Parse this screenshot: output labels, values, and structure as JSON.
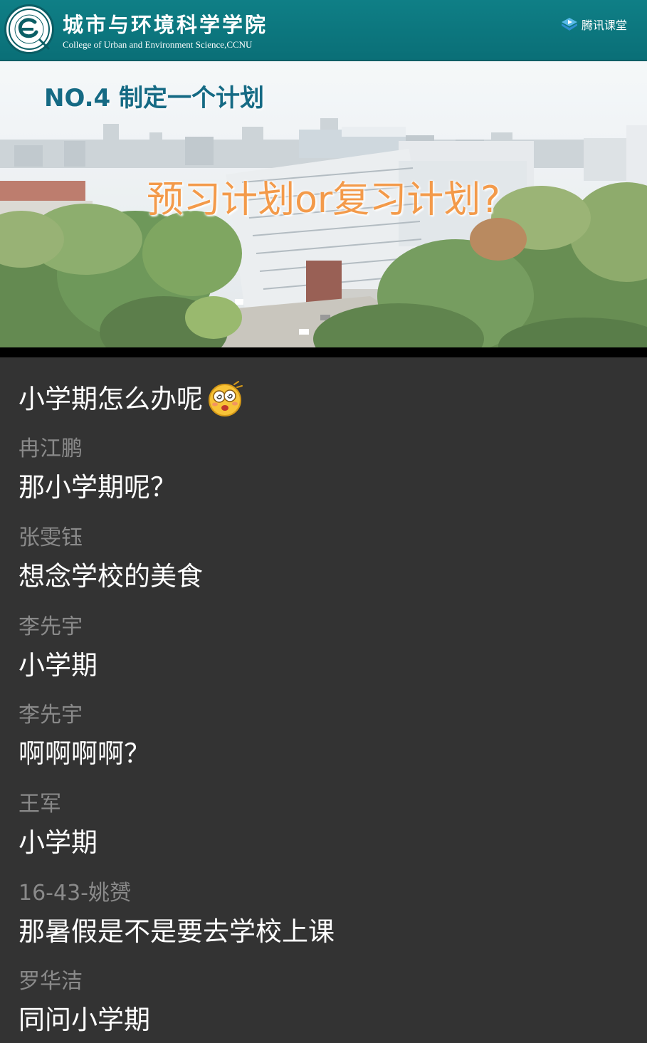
{
  "slide": {
    "college_name_cn": "城市与环境科学学院",
    "college_name_en": "College of Urban and Environment Science,CCNU",
    "platform_name": "腾讯课堂",
    "title": "NO.4  制定一个计划",
    "question": "预习计划or复习计划?"
  },
  "chat": {
    "first_message": {
      "text": "小学期怎么办呢",
      "emoji": "dizzy-face-emoji"
    },
    "messages": [
      {
        "sender": "冉江鹏",
        "text": "那小学期呢？"
      },
      {
        "sender": "张雯钰",
        "text": "想念学校的美食"
      },
      {
        "sender": "李先宇",
        "text": "小学期"
      },
      {
        "sender": "李先宇",
        "text": "啊啊啊啊？"
      },
      {
        "sender": "王军",
        "text": "小学期"
      },
      {
        "sender": "16-43-姚赟",
        "text": "那暑假是不是要去学校上课"
      },
      {
        "sender": "罗华洁",
        "text": "同问小学期"
      }
    ]
  },
  "colors": {
    "header_teal": "#0f7f86",
    "title_blue": "#156a84",
    "question_orange": "#f39a4a",
    "chat_background": "#333333",
    "sender_gray": "#8a8a8a",
    "message_white": "#ffffff"
  }
}
